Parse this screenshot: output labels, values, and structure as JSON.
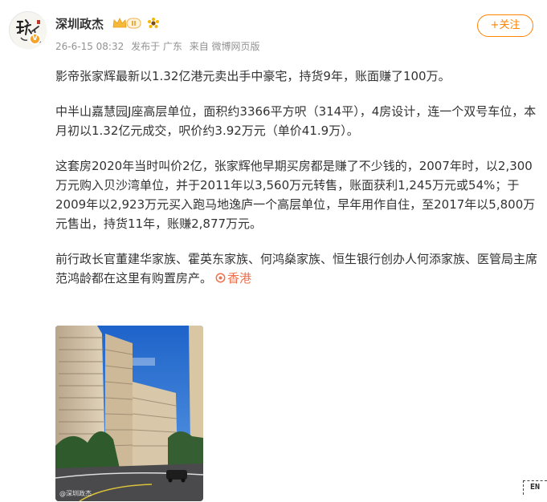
{
  "user": {
    "name": "深圳政杰",
    "avatar_text": "政杰",
    "verified_mark": "V",
    "badge_text": "II"
  },
  "meta": {
    "time": "26-6-15 08:32",
    "location": "发布于 广东",
    "source": "来自 微博网页版"
  },
  "follow_label": "+关注",
  "post": {
    "paragraphs": [
      "影帝张家辉最新以1.32亿港元卖出手中豪宅，持货9年，账面赚了100万。",
      "中半山嘉慧园J座高层单位，面积约3366平方呎（314平），4房设计，连一个双号车位，本月初以1.32亿元成交，呎价约3.92万元（单价41.9万）。",
      "这套房2020年当时叫价2亿，张家辉他早期买房都是赚了不少钱的，2007年时，以2,300万元购入贝沙湾单位，并于2011年以3,560万元转售，账面获利1,245万元或54%；于2009年以2,923万元买入跑马地逸庐一个高层单位，早年用作自住，至2017年以5,800万元售出，持货11年，账赚2,877万元。"
    ],
    "last_paragraph": "前行政长官董建华家族、霍英东家族、何鸿燊家族、恒生银行创办人何添家族、医管局主席范鸿龄都在这里有购置房产。",
    "location_tag": "香港"
  },
  "image": {
    "watermark": "@深圳政杰"
  },
  "en_button": "EN",
  "colors": {
    "accent": "#ff8200",
    "link": "#eb7350",
    "meta_gray": "#939393"
  }
}
